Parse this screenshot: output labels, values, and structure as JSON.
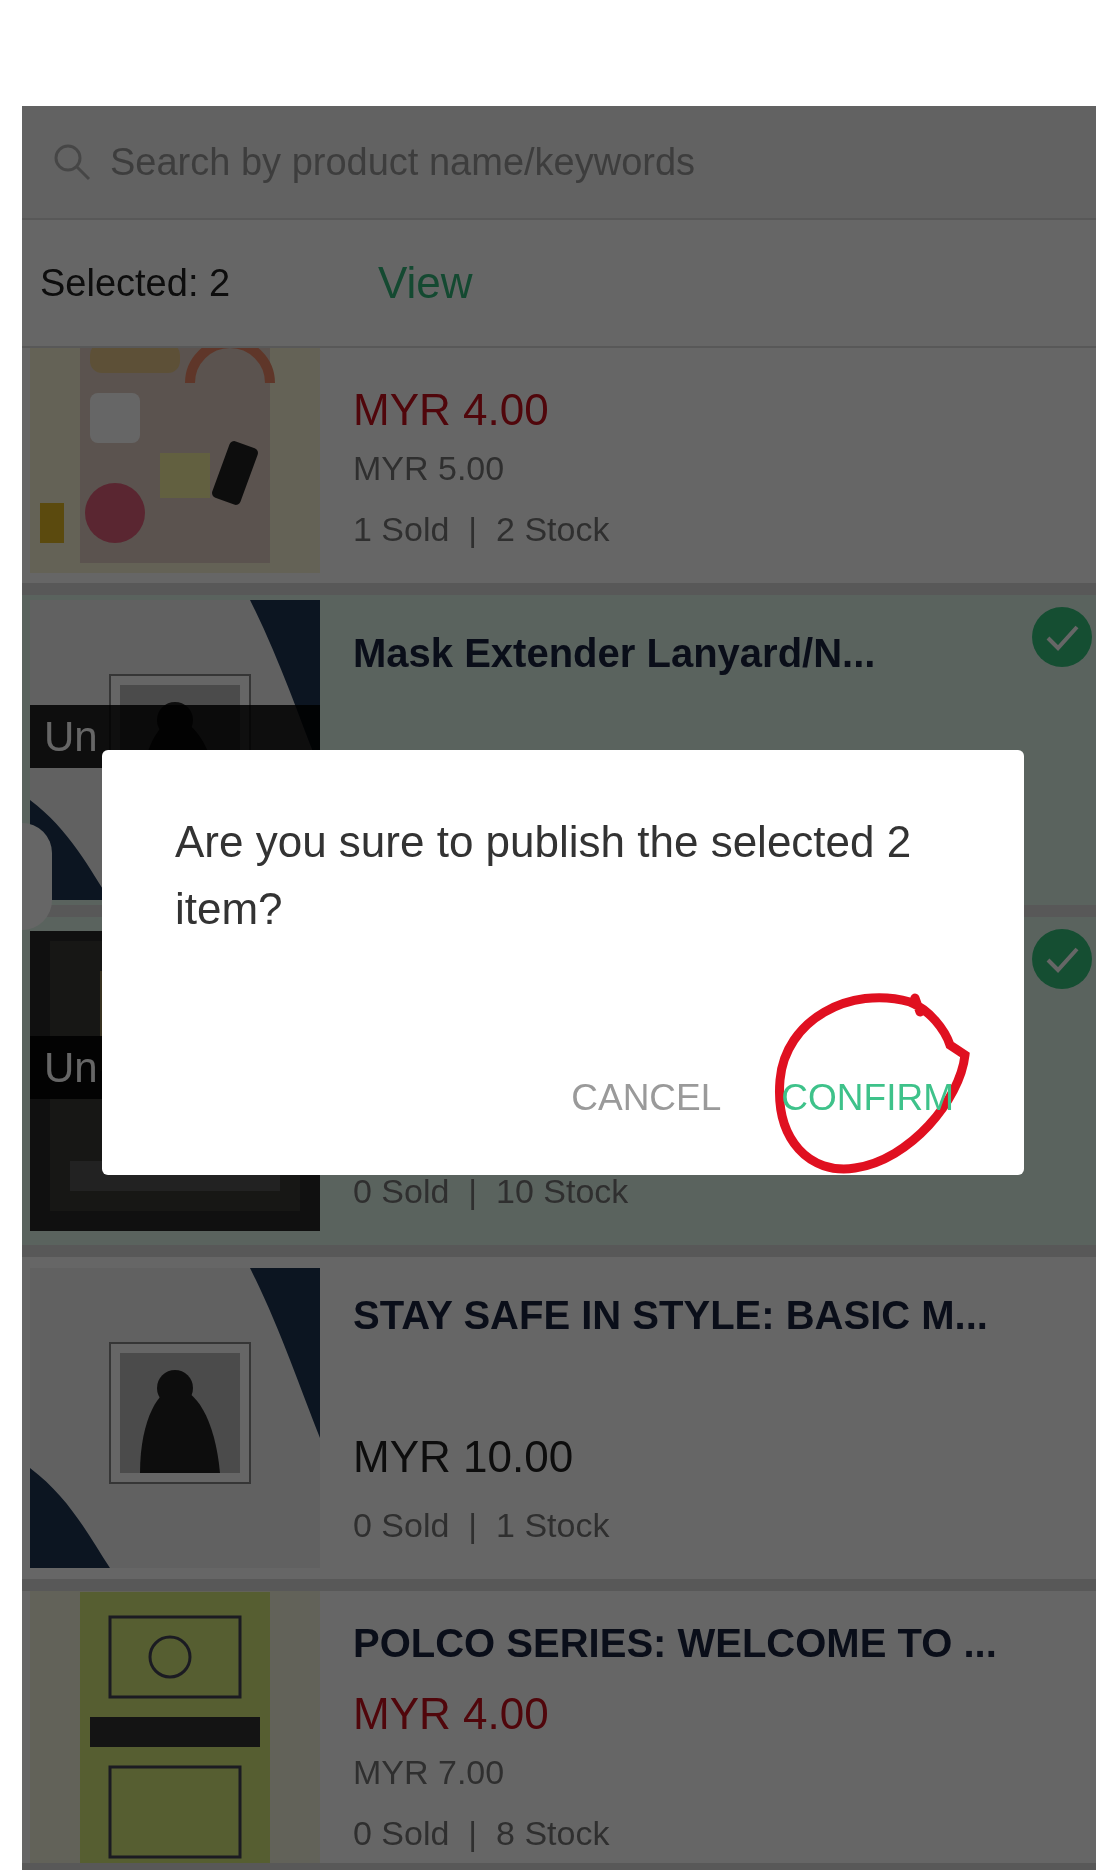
{
  "search": {
    "placeholder": "Search by product name/keywords"
  },
  "selection": {
    "label": "Selected: 2",
    "action": "View"
  },
  "products": [
    {
      "selected": false,
      "price": "MYR 4.00",
      "discounted": true,
      "original_price": "MYR 5.00",
      "stock": "1 Sold  |  2 Stock"
    },
    {
      "selected": true,
      "status": "Un",
      "title": "Mask Extender Lanyard/N..."
    },
    {
      "selected": true,
      "status": "Un",
      "stock": "0 Sold  |  10 Stock"
    },
    {
      "selected": false,
      "title": "STAY SAFE IN STYLE: BASIC M...",
      "price": "MYR 10.00",
      "discounted": false,
      "stock": "0 Sold  |  1 Stock"
    },
    {
      "selected": false,
      "title": "POLCO SERIES: WELCOME TO ...",
      "price": "MYR 4.00",
      "discounted": true,
      "original_price": "MYR 7.00",
      "stock": "0 Sold  |  8 Stock"
    }
  ],
  "dialog": {
    "message": "Are you sure to publish the selected 2 item?",
    "buttons": [
      {
        "label": "CANCEL",
        "kind": "cancel"
      },
      {
        "label": "CONFIRM",
        "kind": "confirm",
        "circled": true
      }
    ]
  }
}
